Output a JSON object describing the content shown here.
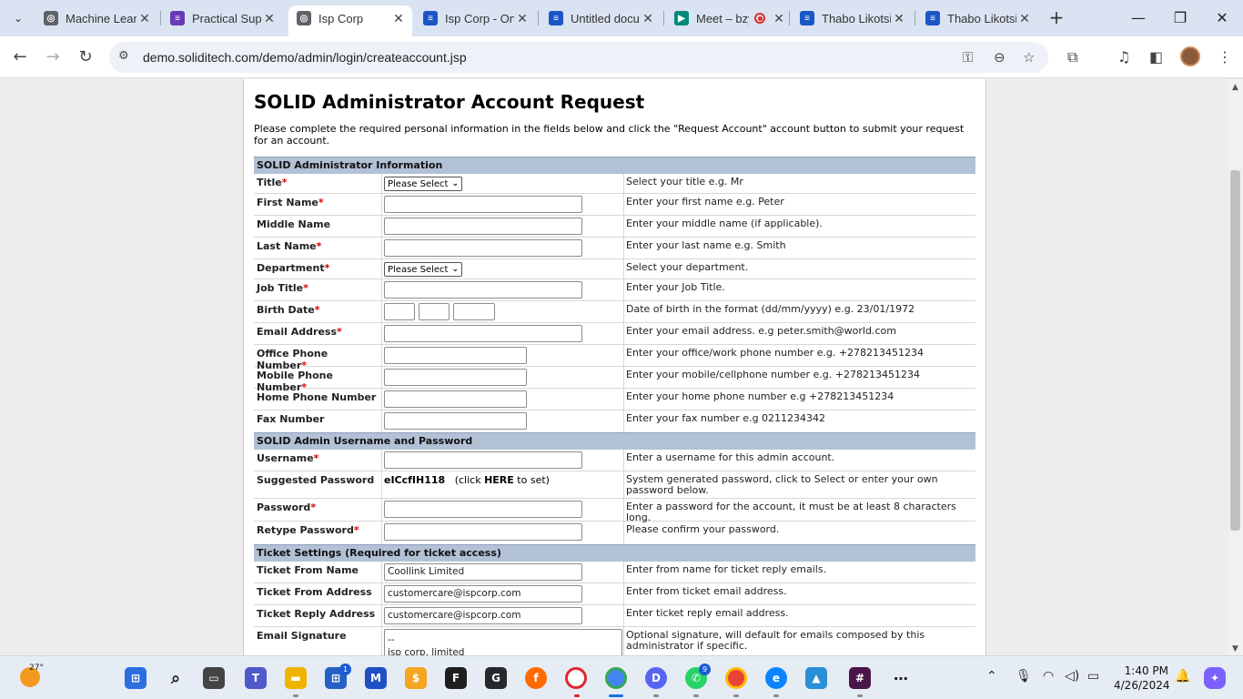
{
  "browser": {
    "tabs": [
      {
        "title": "Machine Learning",
        "favicon": "globe-icon",
        "active": false
      },
      {
        "title": "Practical Supervised",
        "favicon": "forms-icon",
        "active": false
      },
      {
        "title": "Isp Corp",
        "favicon": "globe-icon",
        "active": true
      },
      {
        "title": "Isp Corp - Online",
        "favicon": "docs-icon",
        "active": false
      },
      {
        "title": "Untitled document",
        "favicon": "docs-icon",
        "active": false
      },
      {
        "title": "Meet – bzy",
        "favicon": "meet-icon",
        "active": false
      },
      {
        "title": "Thabo Likotsi",
        "favicon": "docs-icon",
        "active": false
      },
      {
        "title": "Thabo Likotsi",
        "favicon": "docs-icon",
        "active": false
      }
    ],
    "url": "demo.soliditech.com/demo/admin/login/createaccount.jsp"
  },
  "page": {
    "title": "SOLID Administrator Account Request",
    "intro": "Please complete the required personal information in the fields below and click the \"Request Account\" account button to submit your request for an account.",
    "sections": {
      "info": "SOLID Administrator Information",
      "credentials": "SOLID Admin Username and Password",
      "ticket": "Ticket Settings (Required for ticket access)"
    },
    "fields": {
      "title": {
        "label": "Title",
        "value": "Please Select",
        "hint": "Select your title e.g. Mr"
      },
      "first_name": {
        "label": "First Name",
        "hint": "Enter your first name e.g. Peter"
      },
      "middle_name": {
        "label": "Middle Name",
        "hint": "Enter your middle name (if applicable)."
      },
      "last_name": {
        "label": "Last Name",
        "hint": "Enter your last name e.g. Smith"
      },
      "department": {
        "label": "Department",
        "value": "Please Select",
        "hint": "Select your department."
      },
      "job_title": {
        "label": "Job Title",
        "hint": "Enter your Job Title."
      },
      "birth_date": {
        "label": "Birth Date",
        "hint": "Date of birth in the format (dd/mm/yyyy) e.g. 23/01/1972"
      },
      "email": {
        "label": "Email Address",
        "hint": "Enter your email address. e.g peter.smith@world.com"
      },
      "office_phone": {
        "label": "Office Phone Number",
        "hint": "Enter your office/work phone number e.g. +278213451234"
      },
      "mobile_phone": {
        "label": "Mobile Phone Number",
        "hint": "Enter your mobile/cellphone number e.g. +278213451234"
      },
      "home_phone": {
        "label": "Home Phone Number",
        "hint": "Enter your home phone number e.g +278213451234"
      },
      "fax": {
        "label": "Fax Number",
        "hint": "Enter your fax number e.g 0211234342"
      },
      "username": {
        "label": "Username",
        "hint": "Enter a username for this admin account."
      },
      "suggested_password": {
        "label": "Suggested Password",
        "value": "eICcfIH118",
        "link_pre": "(click ",
        "link": "HERE",
        "link_post": " to set)",
        "hint": "System generated password, click to Select or enter your own password below."
      },
      "password": {
        "label": "Password",
        "hint": "Enter a password for the account, it must be at least 8 characters long."
      },
      "retype_password": {
        "label": "Retype Password",
        "hint": "Please confirm your password."
      },
      "ticket_from_name": {
        "label": "Ticket From Name",
        "value": "Coollink Limited",
        "hint": "Enter from name for ticket reply emails."
      },
      "ticket_from_address": {
        "label": "Ticket From Address",
        "value": "customercare@ispcorp.com",
        "hint": "Enter from ticket email address."
      },
      "ticket_reply_address": {
        "label": "Ticket Reply Address",
        "value": "customercare@ispcorp.com",
        "hint": "Enter ticket reply email address."
      },
      "email_signature": {
        "label": "Email Signature",
        "value": "--\nisp corp. limited",
        "hint": "Optional signature, will default for emails composed by this administrator if specific."
      }
    },
    "required_marker": "*"
  },
  "taskbar": {
    "temperature": "27°",
    "time": "1:40 PM",
    "date": "4/26/2024",
    "badges": {
      "store": "1",
      "discord": "9"
    }
  }
}
